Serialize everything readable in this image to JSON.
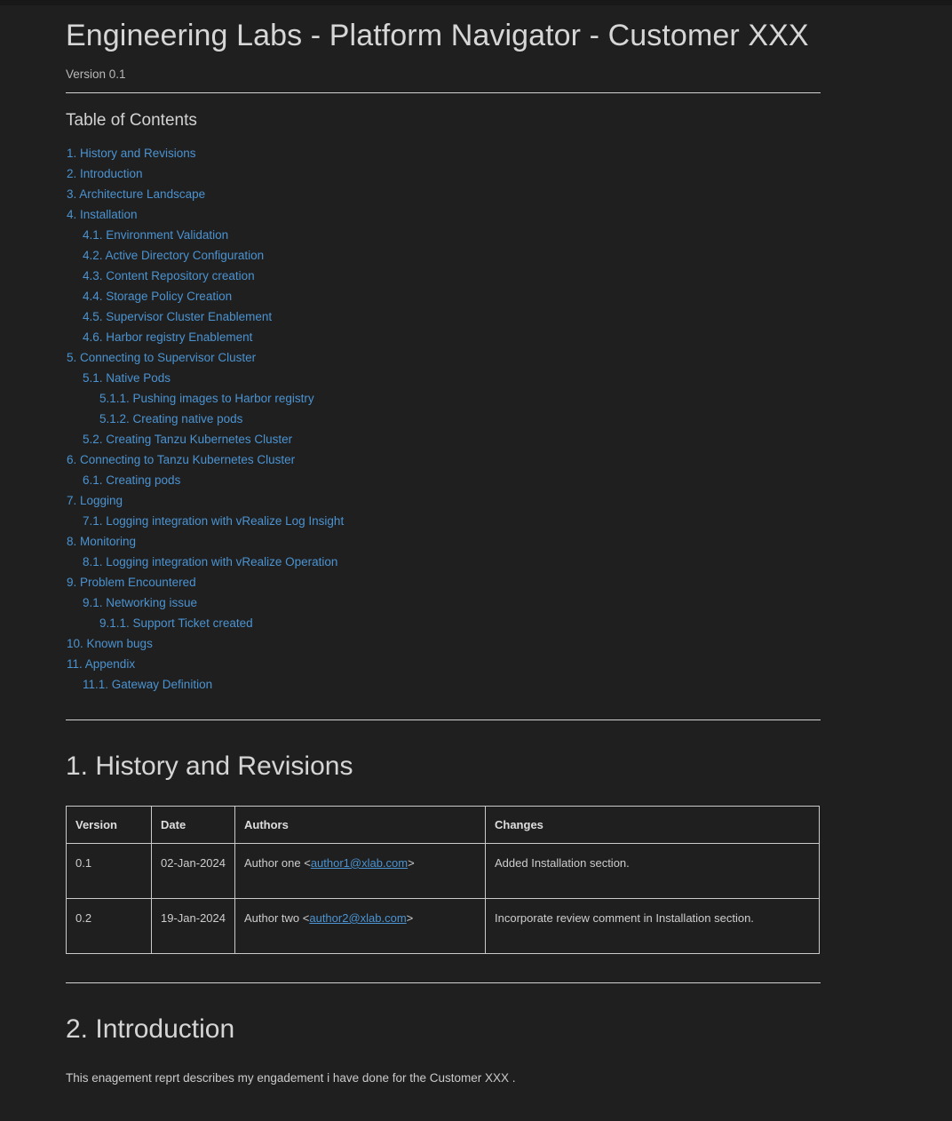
{
  "document": {
    "title": "Engineering Labs - Platform Navigator - Customer XXX",
    "version_line": "Version 0.1"
  },
  "toc": {
    "heading": "Table of Contents",
    "items": [
      {
        "label": "1. History and Revisions",
        "level": 1
      },
      {
        "label": "2. Introduction",
        "level": 1
      },
      {
        "label": "3. Architecture Landscape",
        "level": 1
      },
      {
        "label": "4. Installation",
        "level": 1
      },
      {
        "label": "4.1. Environment Validation",
        "level": 2
      },
      {
        "label": "4.2. Active Directory Configuration",
        "level": 2
      },
      {
        "label": "4.3. Content Repository creation",
        "level": 2
      },
      {
        "label": "4.4. Storage Policy Creation",
        "level": 2
      },
      {
        "label": "4.5. Supervisor Cluster Enablement",
        "level": 2
      },
      {
        "label": "4.6. Harbor registry Enablement",
        "level": 2
      },
      {
        "label": "5. Connecting to Supervisor Cluster",
        "level": 1
      },
      {
        "label": "5.1. Native Pods",
        "level": 2
      },
      {
        "label": "5.1.1. Pushing images to Harbor registry",
        "level": 3
      },
      {
        "label": "5.1.2. Creating native pods",
        "level": 3
      },
      {
        "label": "5.2. Creating Tanzu Kubernetes Cluster",
        "level": 2
      },
      {
        "label": "6. Connecting to Tanzu Kubernetes Cluster",
        "level": 1
      },
      {
        "label": "6.1. Creating pods",
        "level": 2
      },
      {
        "label": "7. Logging",
        "level": 1
      },
      {
        "label": "7.1. Logging integration with vRealize Log Insight",
        "level": 2
      },
      {
        "label": "8. Monitoring",
        "level": 1
      },
      {
        "label": "8.1. Logging integration with vRealize Operation",
        "level": 2
      },
      {
        "label": "9. Problem Encountered",
        "level": 1
      },
      {
        "label": "9.1. Networking issue",
        "level": 2
      },
      {
        "label": "9.1.1. Support Ticket created",
        "level": 3
      },
      {
        "label": "10. Known bugs",
        "level": 1
      },
      {
        "label": "11. Appendix",
        "level": 1
      },
      {
        "label": "11.1. Gateway Definition",
        "level": 2
      }
    ]
  },
  "sections": {
    "history": {
      "heading": "1. History and Revisions",
      "table": {
        "columns": [
          "Version",
          "Date",
          "Authors",
          "Changes"
        ],
        "rows": [
          {
            "version": "0.1",
            "date": "02-Jan-2024",
            "author_prefix": "Author one <",
            "author_email": "author1@xlab.com",
            "author_suffix": ">",
            "changes": "Added Installation section."
          },
          {
            "version": "0.2",
            "date": "19-Jan-2024",
            "author_prefix": "Author two <",
            "author_email": "author2@xlab.com",
            "author_suffix": ">",
            "changes": "Incorporate review comment in Installation section."
          }
        ]
      }
    },
    "introduction": {
      "heading": "2. Introduction",
      "body": "This enagement reprt describes my engadement i have done for the Customer XXX ."
    }
  },
  "theme": {
    "background": "#1f1f1f",
    "top_strip": "#181818",
    "text": "#cfcfcf",
    "link": "#4b93d1",
    "rule": "#d2d2d2",
    "table_border": "#cacaca"
  }
}
